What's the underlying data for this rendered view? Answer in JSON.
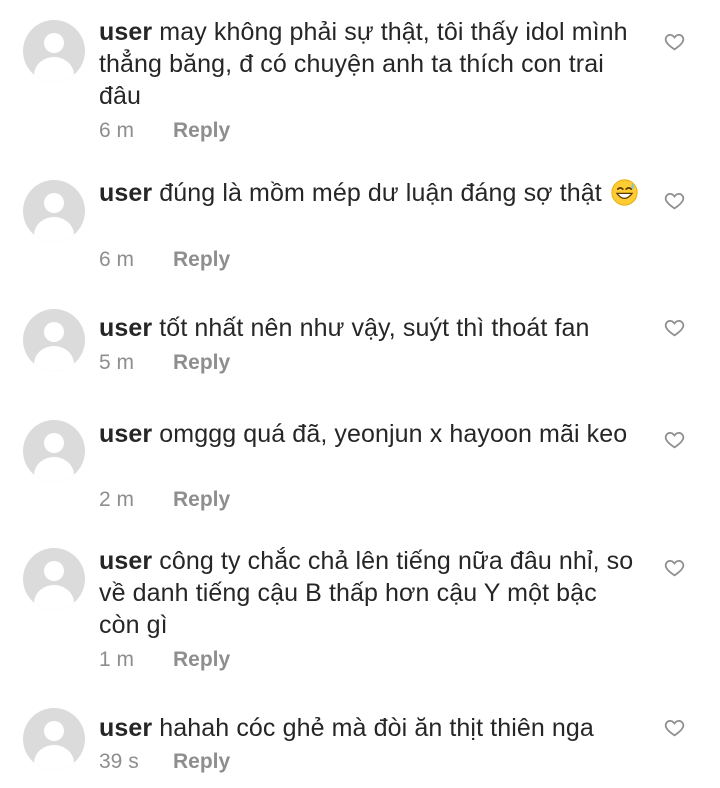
{
  "comments": [
    {
      "username": "user",
      "text": "may không phải sự thật, tôi thấy idol mình thẳng băng, đ có chuyện anh ta thích con trai đâu",
      "time": "6 m",
      "reply": "Reply",
      "emoji": ""
    },
    {
      "username": "user",
      "text": "đúng là mồm mép dư luận đáng sợ thật",
      "time": "6 m",
      "reply": "Reply",
      "emoji": "grinning-sweat-emoji"
    },
    {
      "username": "user",
      "text": "tốt nhất nên như vậy, suýt thì thoát fan",
      "time": "5 m",
      "reply": "Reply",
      "emoji": ""
    },
    {
      "username": "user",
      "text": "omggg quá đã, yeonjun x hayoon mãi keo",
      "time": "2 m",
      "reply": "Reply",
      "emoji": ""
    },
    {
      "username": "user",
      "text": "công ty chắc chả lên tiếng nữa đâu nhỉ, so về danh tiếng cậu B thấp hơn cậu Y một bậc còn gì",
      "time": "1 m",
      "reply": "Reply",
      "emoji": ""
    },
    {
      "username": "user",
      "text": "hahah cóc ghẻ mà đòi ăn thịt thiên nga",
      "time": "39 s",
      "reply": "Reply",
      "emoji": ""
    }
  ],
  "icons": {
    "avatar": "default-avatar-icon",
    "like": "heart-outline-icon"
  },
  "colors": {
    "text": "#262626",
    "secondary": "#8e8e8e",
    "avatar_bg": "#dbdbdb"
  }
}
